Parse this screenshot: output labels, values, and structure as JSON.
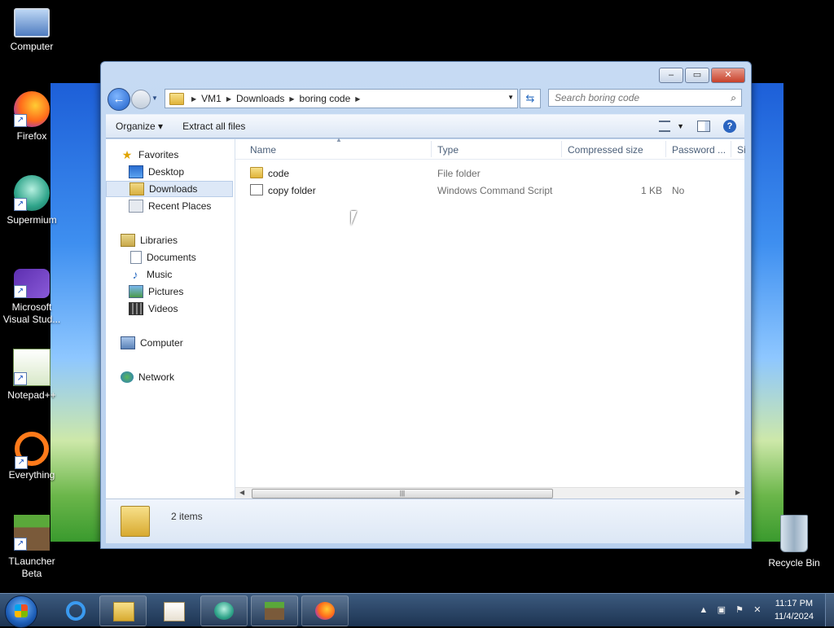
{
  "desktop": {
    "icons": [
      {
        "label": "Computer"
      },
      {
        "label": "Firefox"
      },
      {
        "label": "Supermium"
      },
      {
        "label": "Microsoft Visual Stud..."
      },
      {
        "label": "Notepad++"
      },
      {
        "label": "Everything"
      },
      {
        "label": "TLauncher Beta"
      },
      {
        "label": "Recycle Bin"
      }
    ]
  },
  "window": {
    "caption_minimize": "–",
    "caption_maximize": "▭",
    "caption_close": "✕",
    "address": {
      "crumbs": [
        "VM1",
        "Downloads",
        "boring code"
      ]
    },
    "search": {
      "placeholder": "Search boring code"
    },
    "toolbar": {
      "organize": "Organize ▾",
      "extract": "Extract all files"
    },
    "nav": {
      "favorites": "Favorites",
      "desktop": "Desktop",
      "downloads": "Downloads",
      "recent": "Recent Places",
      "libraries": "Libraries",
      "documents": "Documents",
      "music": "Music",
      "pictures": "Pictures",
      "videos": "Videos",
      "computer": "Computer",
      "network": "Network"
    },
    "columns": {
      "name": "Name",
      "type": "Type",
      "compressed": "Compressed size",
      "password": "Password ...",
      "size": "Si"
    },
    "files": [
      {
        "name": "code",
        "type": "File folder",
        "compressed": "",
        "password": ""
      },
      {
        "name": "copy folder",
        "type": "Windows Command Script",
        "compressed": "1 KB",
        "password": "No"
      }
    ],
    "status": {
      "count": "2 items"
    }
  },
  "taskbar": {
    "clock_time": "11:17 PM",
    "clock_date": "11/4/2024",
    "tray_chevron": "▲"
  }
}
